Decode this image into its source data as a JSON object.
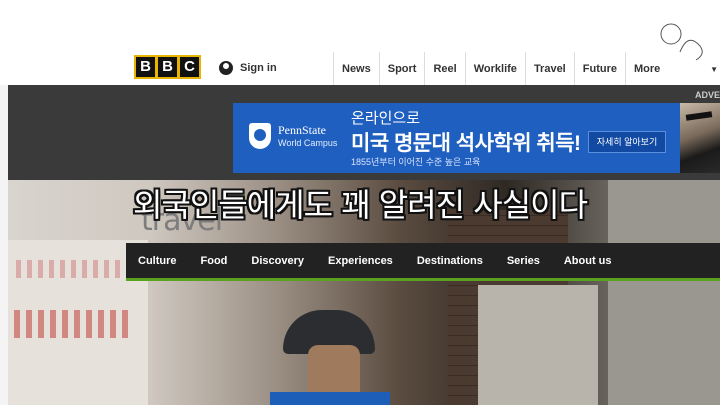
{
  "header": {
    "logo_letters": [
      "B",
      "B",
      "C"
    ],
    "sign_in": "Sign in",
    "nav": [
      "News",
      "Sport",
      "Reel",
      "Worklife",
      "Travel",
      "Future"
    ],
    "more": "More",
    "advert_label": "ADVE"
  },
  "ad": {
    "brand_name": "PennState",
    "brand_sub": "World Campus",
    "headline_top": "온라인으로",
    "headline_main": "미국 명문대 석사학위 취득!",
    "subline": "1855년부터 이어진 수준 높은 교육",
    "cta": "자세히 알아보기"
  },
  "travel": {
    "logo": "travel",
    "subnav": [
      "Culture",
      "Food",
      "Discovery",
      "Experiences",
      "Destinations",
      "Series",
      "About us"
    ]
  },
  "caption": "외국인들에게도 꽤 알려진 사실이다",
  "colors": {
    "bbc_logo_border": "#e8b400",
    "ad_blue": "#1f5fbf",
    "subnav_bg": "#222222",
    "subnav_accent": "#5aa21e"
  },
  "icons": {
    "user": "avatar-icon",
    "chevron": "chevron-down-icon",
    "watermark": "channel-watermark-icon"
  }
}
